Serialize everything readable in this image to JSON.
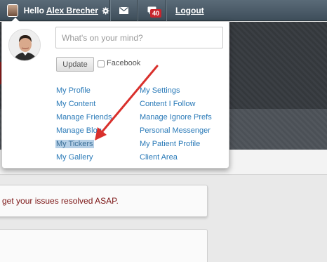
{
  "topbar": {
    "greeting": "Hello",
    "user_name": "Alex Brecher",
    "message_count": "40",
    "logout_label": "Logout"
  },
  "dropdown": {
    "status_placeholder": "What's on your mind?",
    "update_label": "Update",
    "facebook_label": "Facebook",
    "left_links": [
      "My Profile",
      "My Content",
      "Manage Friends",
      "Manage Blog",
      "My Tickers",
      "My Gallery"
    ],
    "right_links": [
      "My Settings",
      "Content I Follow",
      "Manage Ignore Prefs",
      "Personal Messenger",
      "My Patient Profile",
      "Client Area"
    ],
    "selected_link": "My Tickers"
  },
  "page": {
    "notice_text": "get your issues resolved ASAP."
  },
  "colors": {
    "link": "#2a7ab8",
    "annotation_arrow": "#d9302c",
    "badge": "#c8252d",
    "topbar": "#4a5b67"
  },
  "icons": [
    "gear-icon",
    "mail-icon",
    "chat-icon",
    "annotation-arrow"
  ]
}
